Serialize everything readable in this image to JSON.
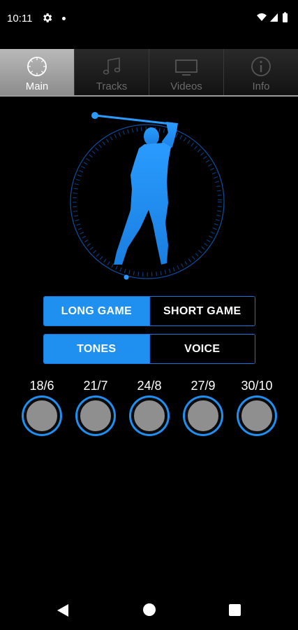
{
  "status_bar": {
    "time": "10:11",
    "icons": [
      "gear-icon",
      "notification-dot-icon",
      "wifi-icon",
      "signal-icon",
      "battery-icon"
    ]
  },
  "tabs": [
    {
      "label": "Main",
      "icon": "stopwatch-icon",
      "active": true
    },
    {
      "label": "Tracks",
      "icon": "music-note-icon",
      "active": false
    },
    {
      "label": "Videos",
      "icon": "tv-icon",
      "active": false
    },
    {
      "label": "Info",
      "icon": "info-icon",
      "active": false
    }
  ],
  "graphic": {
    "icon": "golfer-swing-icon",
    "accent_color": "#1f8ff0"
  },
  "game_mode": {
    "options": [
      "LONG GAME",
      "SHORT GAME"
    ],
    "selected": "LONG GAME"
  },
  "audio_mode": {
    "options": [
      "TONES",
      "VOICE"
    ],
    "selected": "TONES"
  },
  "tempos": [
    {
      "label": "18/6"
    },
    {
      "label": "21/7"
    },
    {
      "label": "24/8"
    },
    {
      "label": "27/9"
    },
    {
      "label": "30/10"
    }
  ],
  "colors": {
    "accent": "#1f90f0",
    "background": "#000000",
    "circle_fill": "#8f8f8f"
  },
  "nav_bar": {
    "icons": [
      "back-icon",
      "home-icon",
      "recents-icon"
    ]
  }
}
